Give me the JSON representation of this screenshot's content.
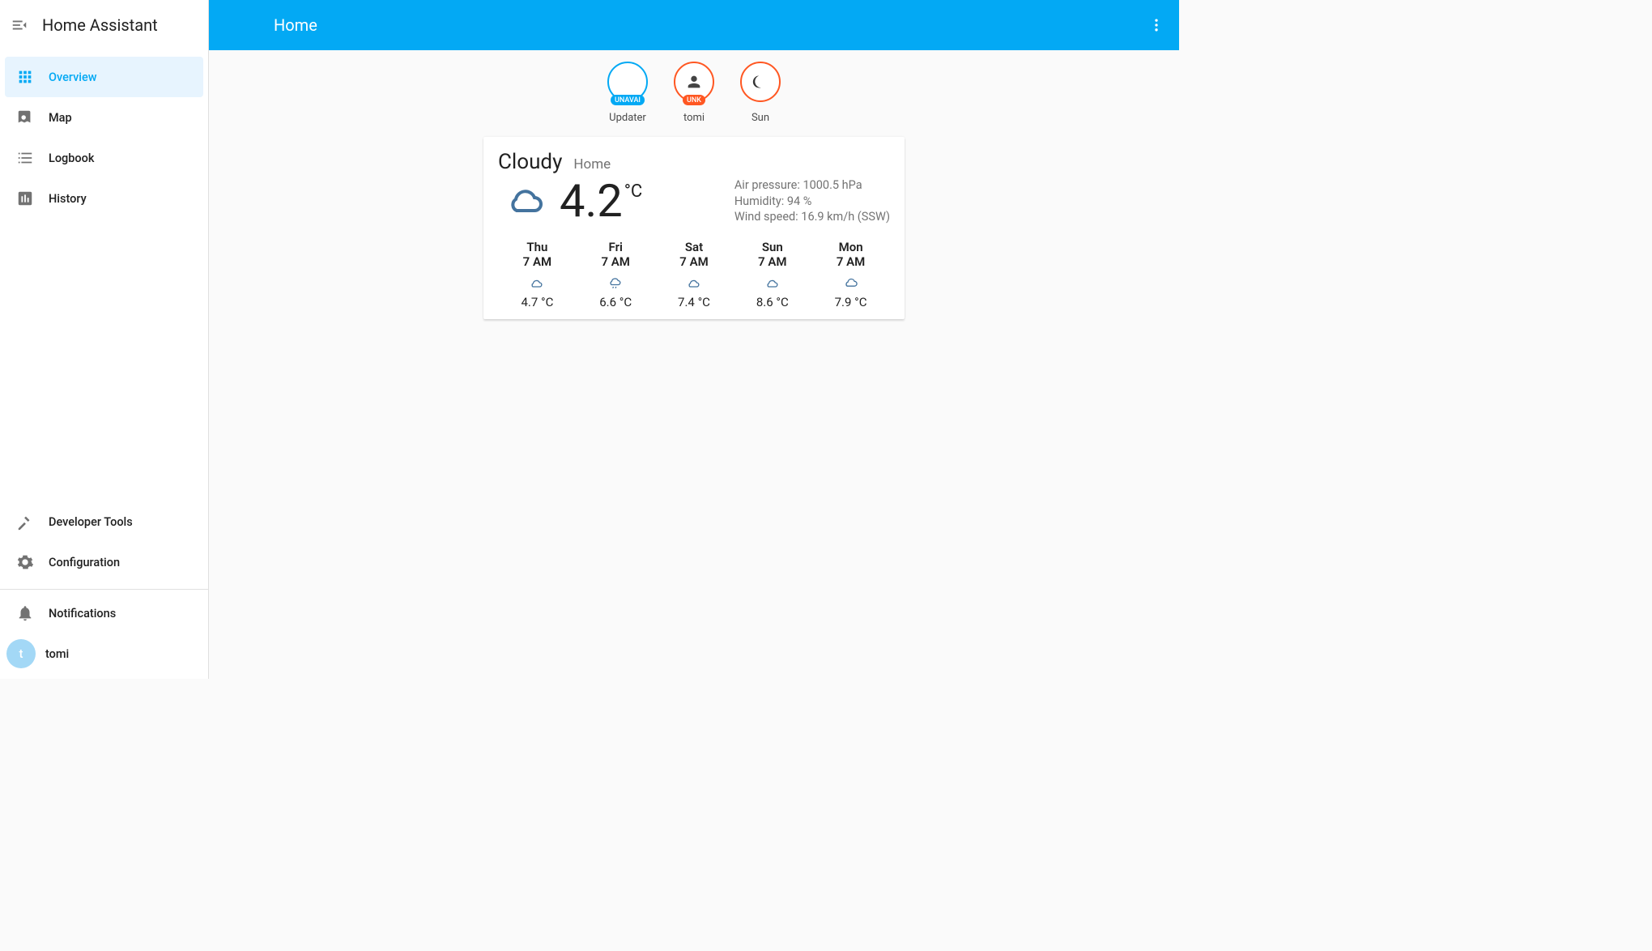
{
  "sidebar": {
    "brand": "Home Assistant",
    "items": [
      {
        "label": "Overview"
      },
      {
        "label": "Map"
      },
      {
        "label": "Logbook"
      },
      {
        "label": "History"
      }
    ],
    "tools": [
      {
        "label": "Developer Tools"
      },
      {
        "label": "Configuration"
      }
    ],
    "notifications_label": "Notifications",
    "user": {
      "name": "tomi",
      "initial": "t"
    }
  },
  "topbar": {
    "title": "Home"
  },
  "badges": [
    {
      "name": "Updater",
      "tag": "UNAVAI",
      "border": "#03a9f4",
      "tag_bg": "#03a9f4",
      "icon": "none"
    },
    {
      "name": "tomi",
      "tag": "UNK",
      "border": "#ff5722",
      "tag_bg": "#ff5722",
      "icon": "person"
    },
    {
      "name": "Sun",
      "tag": "",
      "border": "#ff5722",
      "tag_bg": "",
      "icon": "moon"
    }
  ],
  "weather": {
    "condition": "Cloudy",
    "place": "Home",
    "temp": "4.2",
    "unit": "°C",
    "attrs": {
      "pressure": "Air pressure: 1000.5 hPa",
      "humidity": "Humidity: 94 %",
      "wind": "Wind speed: 16.9 km/h (SSW)"
    },
    "forecast": [
      {
        "day": "Thu",
        "time": "7 AM",
        "icon": "partly",
        "temp": "4.7 °C"
      },
      {
        "day": "Fri",
        "time": "7 AM",
        "icon": "rainy",
        "temp": "6.6 °C"
      },
      {
        "day": "Sat",
        "time": "7 AM",
        "icon": "partly",
        "temp": "7.4 °C"
      },
      {
        "day": "Sun",
        "time": "7 AM",
        "icon": "partly",
        "temp": "8.6 °C"
      },
      {
        "day": "Mon",
        "time": "7 AM",
        "icon": "cloudy",
        "temp": "7.9 °C"
      }
    ]
  }
}
